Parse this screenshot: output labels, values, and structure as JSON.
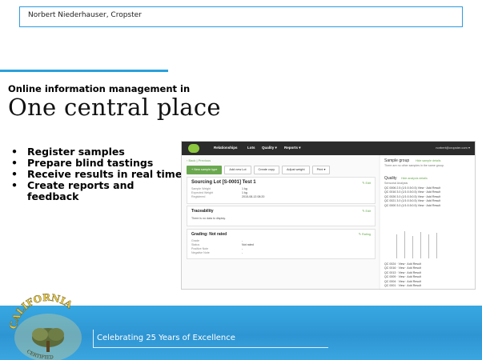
{
  "header": {
    "speaker": "Norbert Niederhauser, Cropster"
  },
  "slide": {
    "kicker": "Online information management in",
    "title": "One central place",
    "bullets": [
      "Register samples",
      "Prepare blind tastings",
      "Receive results in real time",
      "Create reports and feedback"
    ]
  },
  "app": {
    "nav": [
      "Relationships",
      "Lots",
      "Quality ▾",
      "Reports ▾"
    ],
    "user": "norbert@cropster.com ▾",
    "breadcrumb": "‹ Back  | Previous",
    "buttons": [
      "+ New sample type",
      "Add new Lot",
      "Create copy",
      "Adjust weight",
      "Print ▾"
    ],
    "lot": {
      "title": "Sourcing Lot [S-0001] Test 1",
      "edit": "✎ Edit",
      "fields": [
        {
          "label": "Sample Weight",
          "value": "1 kg"
        },
        {
          "label": "Expected Weight",
          "value": "1 kg"
        },
        {
          "label": "Registered",
          "value": "2015-08-13 08:20"
        }
      ]
    },
    "traceability": {
      "title": "Traceability",
      "edit": "✎ Edit",
      "empty": "There is no data to display."
    },
    "grading": {
      "title": "Grading: Not rated",
      "edit": "✎ Rating",
      "fields": [
        {
          "label": "Grade",
          "value": "-"
        },
        {
          "label": "Status",
          "value": "Not rated"
        },
        {
          "label": "Positive Note",
          "value": "-"
        },
        {
          "label": "Negative Note",
          "value": "-"
        }
      ]
    },
    "sidebar": {
      "group_title": "Sample group",
      "group_link": "Hide sample details",
      "group_note": "There are no other samples in the same group.",
      "quality_title": "Quality",
      "quality_link": "Hide analysis details",
      "analysis_label": "Sensorial Analysis",
      "analyses": [
        "QC 0006  2.5 (1/1:0.5:0.5)  View · Add Result",
        "QC 0016  3.0 (1/1:0.5:0.5)  View · Add Result",
        "QC 0026  3.0 (1/1:0.5:0.5)  View · Add Result",
        "QC 0021  3.0 (1/1:0.5:0.5)  View · Add Result",
        "QC 0000  3.0 (1/1:0.5:0.5)  View · Add Result"
      ],
      "results": [
        "QC 0024 · View · Add Result",
        "QC 0016 · View · Add Result",
        "QC 0013 · View · Add Result",
        "QC 0009 · View · Add Result",
        "QC 0004 · View · Add Result",
        "QC 0001 · View · Add Result"
      ]
    }
  },
  "footer": {
    "text": "Celebrating 25 Years of Excellence"
  },
  "seal": {
    "text": "CALIFORNIA",
    "subtext": "CERTIFIED"
  },
  "colors": {
    "accent": "#2aa0dc",
    "footer": "#37a8e2",
    "app_green": "#6aa84f",
    "app_dark": "#2b2b2b"
  }
}
